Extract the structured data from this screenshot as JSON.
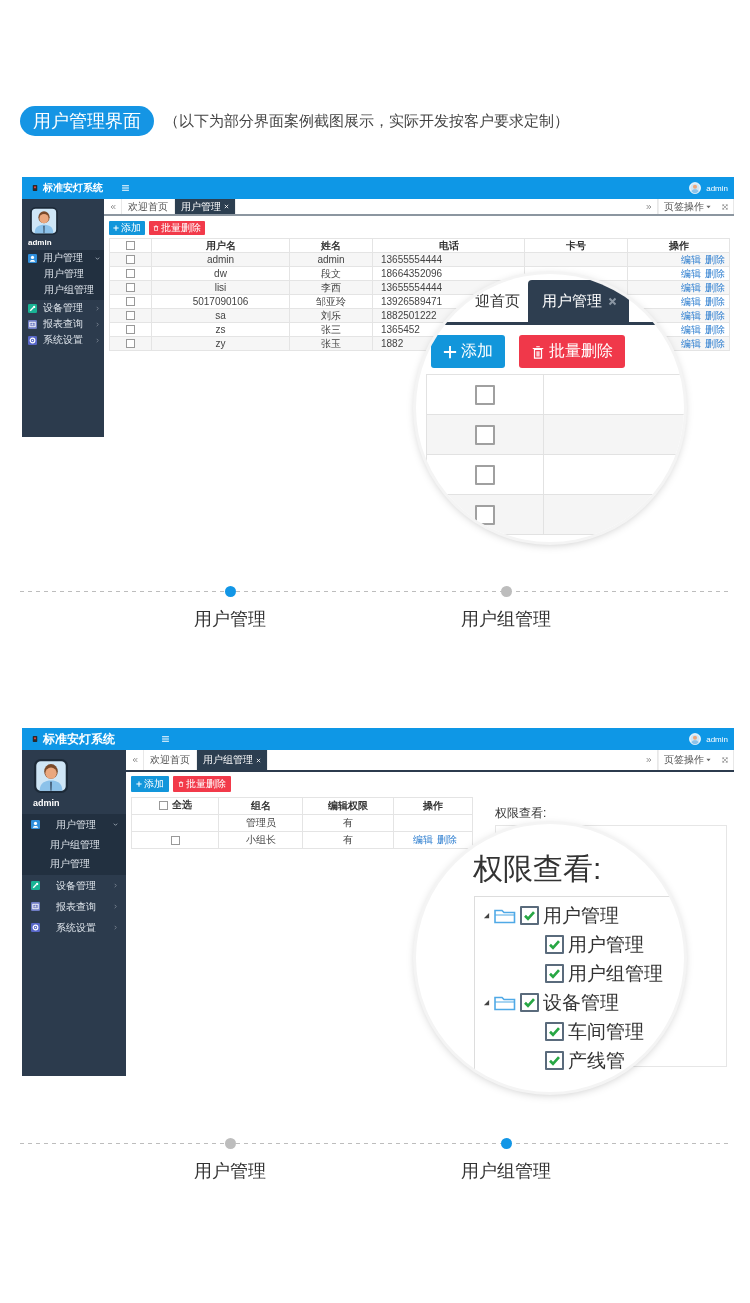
{
  "section_title": {
    "badge": "用户管理界面",
    "note": "（以下为部分界面案例截图展示，实际开发按客户要求定制）"
  },
  "slides": [
    {
      "kind": "users",
      "app": {
        "title": "标准安灯系统",
        "user": "admin",
        "sidebar_user": "admin",
        "menu": [
          {
            "label": "用户管理",
            "kind": "user",
            "expanded": true,
            "children": [
              {
                "label": "用户管理"
              },
              {
                "label": "用户组管理"
              }
            ]
          },
          {
            "label": "设备管理",
            "kind": "wrench",
            "expanded": false
          },
          {
            "label": "报表查询",
            "kind": "report",
            "expanded": false
          },
          {
            "label": "系统设置",
            "kind": "gear",
            "expanded": false
          }
        ],
        "tabs": [
          {
            "label": "欢迎首页",
            "selected": false,
            "closable": false
          },
          {
            "label": "用户管理",
            "selected": true,
            "closable": true
          }
        ],
        "tab_menu": "页签操作",
        "add_button": "添加",
        "delete_button": "批量删除"
      },
      "table": {
        "header_checked": false,
        "columns": [
          "用户名",
          "姓名",
          "电话",
          "卡号",
          "操作"
        ],
        "rows": [
          {
            "checked": false,
            "username": "admin",
            "name": "admin",
            "phone": "13655554444",
            "links": [
              "编辑",
              "删除"
            ]
          },
          {
            "checked": false,
            "username": "dw",
            "name": "段文",
            "phone": "18664352096",
            "links": [
              "编辑",
              "删除"
            ]
          },
          {
            "checked": false,
            "username": "lisi",
            "name": "李西",
            "phone": "13655554444",
            "links": [
              "编辑",
              "删除"
            ]
          },
          {
            "checked": false,
            "username": "5017090106",
            "name": "邹亚玲",
            "phone": "13926589471",
            "links": [
              "编辑",
              "删除"
            ]
          },
          {
            "checked": false,
            "username": "sa",
            "name": "刘乐",
            "phone": "1882501222",
            "links": [
              "编辑",
              "删除"
            ]
          },
          {
            "checked": false,
            "username": "zs",
            "name": "张三",
            "phone": "1365452",
            "links": [
              "编辑",
              "删除"
            ]
          },
          {
            "checked": false,
            "username": "zy",
            "name": "张玉",
            "phone": "1882",
            "links": [
              "编辑",
              "删除"
            ]
          }
        ]
      },
      "zoom": {
        "kind": "tabs",
        "tabs": [
          {
            "label": "迎首页",
            "selected": false,
            "closable": false
          },
          {
            "label": "用户管理",
            "selected": true,
            "closable": true
          }
        ],
        "add_button": "添加",
        "delete_button": "批量删除",
        "rows": [
          {
            "checked": false
          },
          {
            "checked": false
          },
          {
            "checked": false
          },
          {
            "checked": false
          }
        ]
      },
      "pager": [
        {
          "label": "用户管理",
          "selected": true
        },
        {
          "label": "用户组管理",
          "selected": false
        }
      ]
    },
    {
      "kind": "groups",
      "app": {
        "title": "标准安灯系统",
        "user": "admin",
        "sidebar_user": "admin",
        "menu": [
          {
            "label": "用户管理",
            "kind": "user",
            "expanded": true,
            "children": [
              {
                "label": "用户组管理"
              },
              {
                "label": "用户管理"
              }
            ]
          },
          {
            "label": "设备管理",
            "kind": "wrench",
            "expanded": false
          },
          {
            "label": "报表查询",
            "kind": "report",
            "expanded": false
          },
          {
            "label": "系统设置",
            "kind": "gear",
            "expanded": false
          }
        ],
        "tabs": [
          {
            "label": "欢迎首页",
            "selected": false,
            "closable": false
          },
          {
            "label": "用户组管理",
            "selected": true,
            "closable": true
          }
        ],
        "tab_menu": "页签操作",
        "add_button": "添加",
        "delete_button": "批量删除"
      },
      "table": {
        "select_all": "全选",
        "header_checked": false,
        "columns": [
          "组名",
          "编辑权限",
          "操作"
        ],
        "rows": [
          {
            "group": "管理员",
            "permission": "有"
          },
          {
            "checked": false,
            "group": "小组长",
            "permission": "有",
            "links": [
              "编辑",
              "删除"
            ]
          }
        ]
      },
      "panel_title": "权限查看:",
      "zoom": {
        "kind": "tree",
        "title": "权限查看:",
        "nodes": [
          {
            "label": "用户管理",
            "expanded": true,
            "checked": true,
            "children": [
              {
                "label": "用户管理",
                "checked": true
              },
              {
                "label": "用户组管理",
                "checked": true
              }
            ]
          },
          {
            "label": "设备管理",
            "expanded": true,
            "checked": true,
            "children": [
              {
                "label": "车间管理",
                "checked": true
              },
              {
                "label": "产线管",
                "checked": true
              }
            ]
          }
        ]
      },
      "pager": [
        {
          "label": "用户管理",
          "selected": false
        },
        {
          "label": "用户组管理",
          "selected": true
        }
      ]
    }
  ]
}
